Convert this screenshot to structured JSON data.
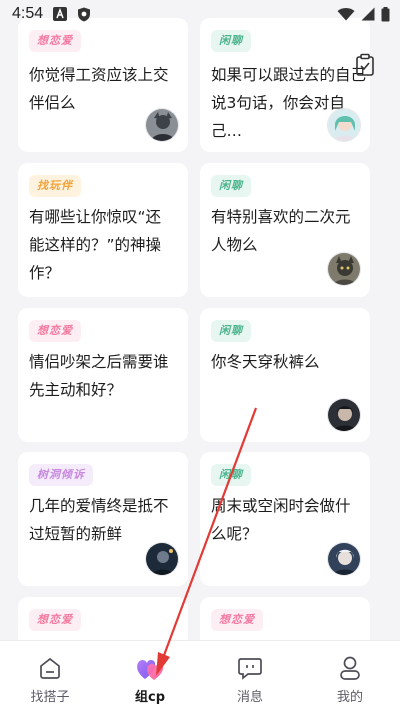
{
  "status_bar": {
    "time": "4:54",
    "left_icons": [
      "a-notification-icon",
      "shield-icon"
    ],
    "right_icons": [
      "wifi-icon",
      "cellular-signal-icon",
      "battery-icon"
    ]
  },
  "colors": {
    "pink_tag_bg": "#fdeef3",
    "pink_tag_text": "#f27aa0",
    "green_tag_bg": "#e8f6f1",
    "green_tag_text": "#4cb58e",
    "orange_tag_bg": "#fff3df",
    "orange_tag_text": "#f2a33a",
    "purple_tag_bg": "#f5ecfb",
    "purple_tag_text": "#c78ae0",
    "arrow": "#e23a35"
  },
  "cards": [
    {
      "tag": "想恋爱",
      "tag_style": "pink",
      "title": "你觉得工资应该上交伴侣么"
    },
    {
      "tag": "闲聊",
      "tag_style": "green",
      "title": "如果可以跟过去的自己说3句话，你会对自己…"
    },
    {
      "tag": "找玩伴",
      "tag_style": "orange",
      "title": "有哪些让你惊叹“还能这样的？”的神操作？"
    },
    {
      "tag": "闲聊",
      "tag_style": "green",
      "title": "有特别喜欢的二次元人物么"
    },
    {
      "tag": "想恋爱",
      "tag_style": "pink",
      "title": "情侣吵架之后需要谁先主动和好？"
    },
    {
      "tag": "闲聊",
      "tag_style": "green",
      "title": "你冬天穿秋裤么"
    },
    {
      "tag": "树洞倾诉",
      "tag_style": "purple",
      "title": "几年的爱情终是抵不过短暂的新鲜"
    },
    {
      "tag": "闲聊",
      "tag_style": "green",
      "title": "周末或空闲时会做什么呢？"
    },
    {
      "tag": "想恋爱",
      "tag_style": "pink",
      "title": ""
    },
    {
      "tag": "想恋爱",
      "tag_style": "pink",
      "title": ""
    }
  ],
  "nav": {
    "items": [
      {
        "label": "找搭子",
        "icon": "home-icon"
      },
      {
        "label": "组cp",
        "icon": "heart-pair-icon"
      },
      {
        "label": "消息",
        "icon": "message-icon"
      },
      {
        "label": "我的",
        "icon": "profile-icon"
      }
    ],
    "active": "组cp"
  }
}
